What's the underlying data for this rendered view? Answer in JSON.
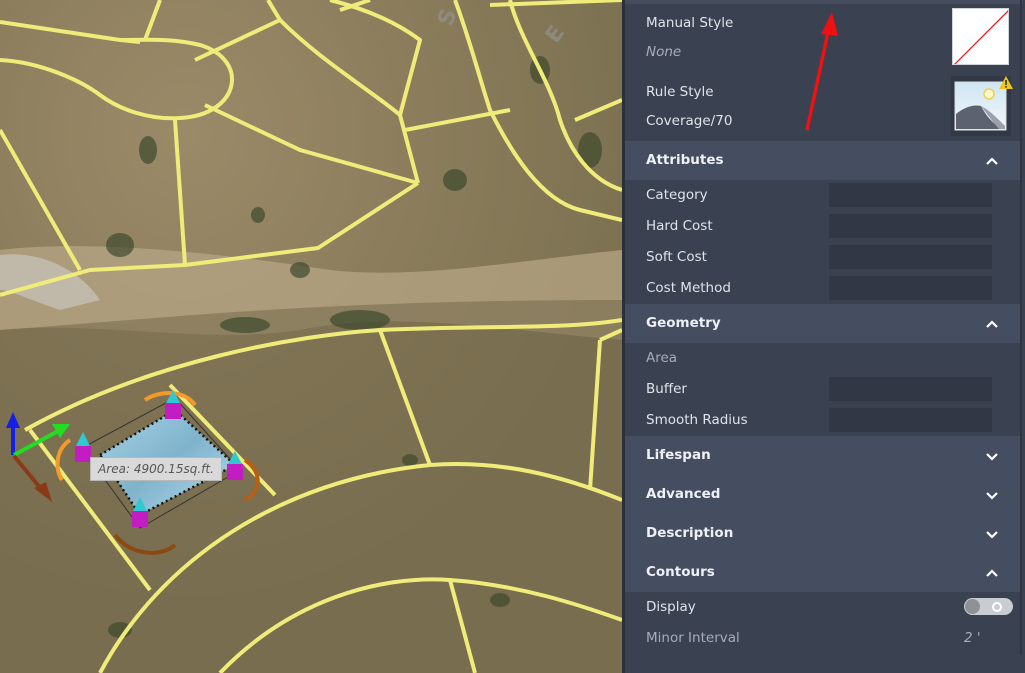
{
  "map": {
    "tooltip": "Area: 4900.15sq.ft.",
    "road_labels": [
      "S",
      "E"
    ],
    "colors": {
      "parcel_line": "#f0ec7a",
      "annotation_arrow": "#ee1111"
    }
  },
  "panel": {
    "style": {
      "manual_style_label": "Manual Style",
      "manual_style_value": "None",
      "rule_style_label": "Rule Style",
      "rule_style_value": "Coverage/70",
      "rule_style_warning": "warning-icon"
    },
    "sections": {
      "attributes": {
        "title": "Attributes",
        "expanded": true,
        "fields": [
          {
            "label": "Category",
            "value": ""
          },
          {
            "label": "Hard Cost",
            "value": ""
          },
          {
            "label": "Soft Cost",
            "value": ""
          },
          {
            "label": "Cost Method",
            "value": ""
          }
        ]
      },
      "geometry": {
        "title": "Geometry",
        "expanded": true,
        "area_label": "Area",
        "fields": [
          {
            "label": "Buffer",
            "value": ""
          },
          {
            "label": "Smooth Radius",
            "value": ""
          }
        ]
      },
      "lifespan": {
        "title": "Lifespan",
        "expanded": false
      },
      "advanced": {
        "title": "Advanced",
        "expanded": false
      },
      "description": {
        "title": "Description",
        "expanded": false
      },
      "contours": {
        "title": "Contours",
        "expanded": true,
        "display_label": "Display",
        "display_on": false,
        "minor_interval_label": "Minor Interval",
        "minor_interval_value": "2 '"
      }
    }
  }
}
